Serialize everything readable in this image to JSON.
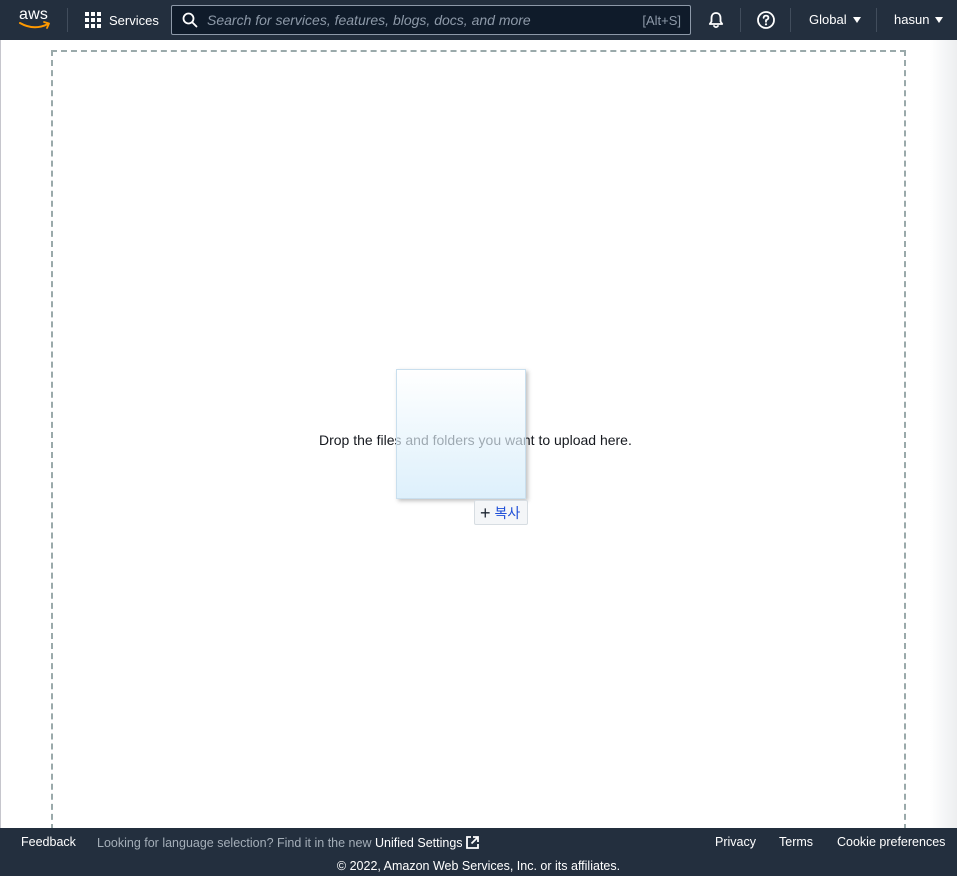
{
  "topbar": {
    "logo_text": "aws",
    "services_label": "Services",
    "search": {
      "placeholder": "Search for services, features, blogs, docs, and more",
      "shortcut": "[Alt+S]"
    },
    "region_label": "Global",
    "user_label": "hasun",
    "icons": [
      "apps-grid-icon",
      "search-icon",
      "notifications-bell-icon",
      "help-icon",
      "caret-down-icon"
    ]
  },
  "main": {
    "drop_text": "Drop the files and folders you want to upload here.",
    "drag_badge": {
      "symbol": "+",
      "label": "복사"
    }
  },
  "footer": {
    "feedback": "Feedback",
    "language_note": "Looking for language selection? Find it in the new ",
    "unified_settings": "Unified Settings",
    "privacy": "Privacy",
    "terms": "Terms",
    "cookie_preferences": "Cookie preferences",
    "copyright": "© 2022, Amazon Web Services, Inc. or its affiliates."
  },
  "colors": {
    "header_bg": "#232f3e",
    "accent_orange": "#ff9900",
    "dropzone_border": "#9aa9aa",
    "badge_text": "#1d4ed8"
  }
}
